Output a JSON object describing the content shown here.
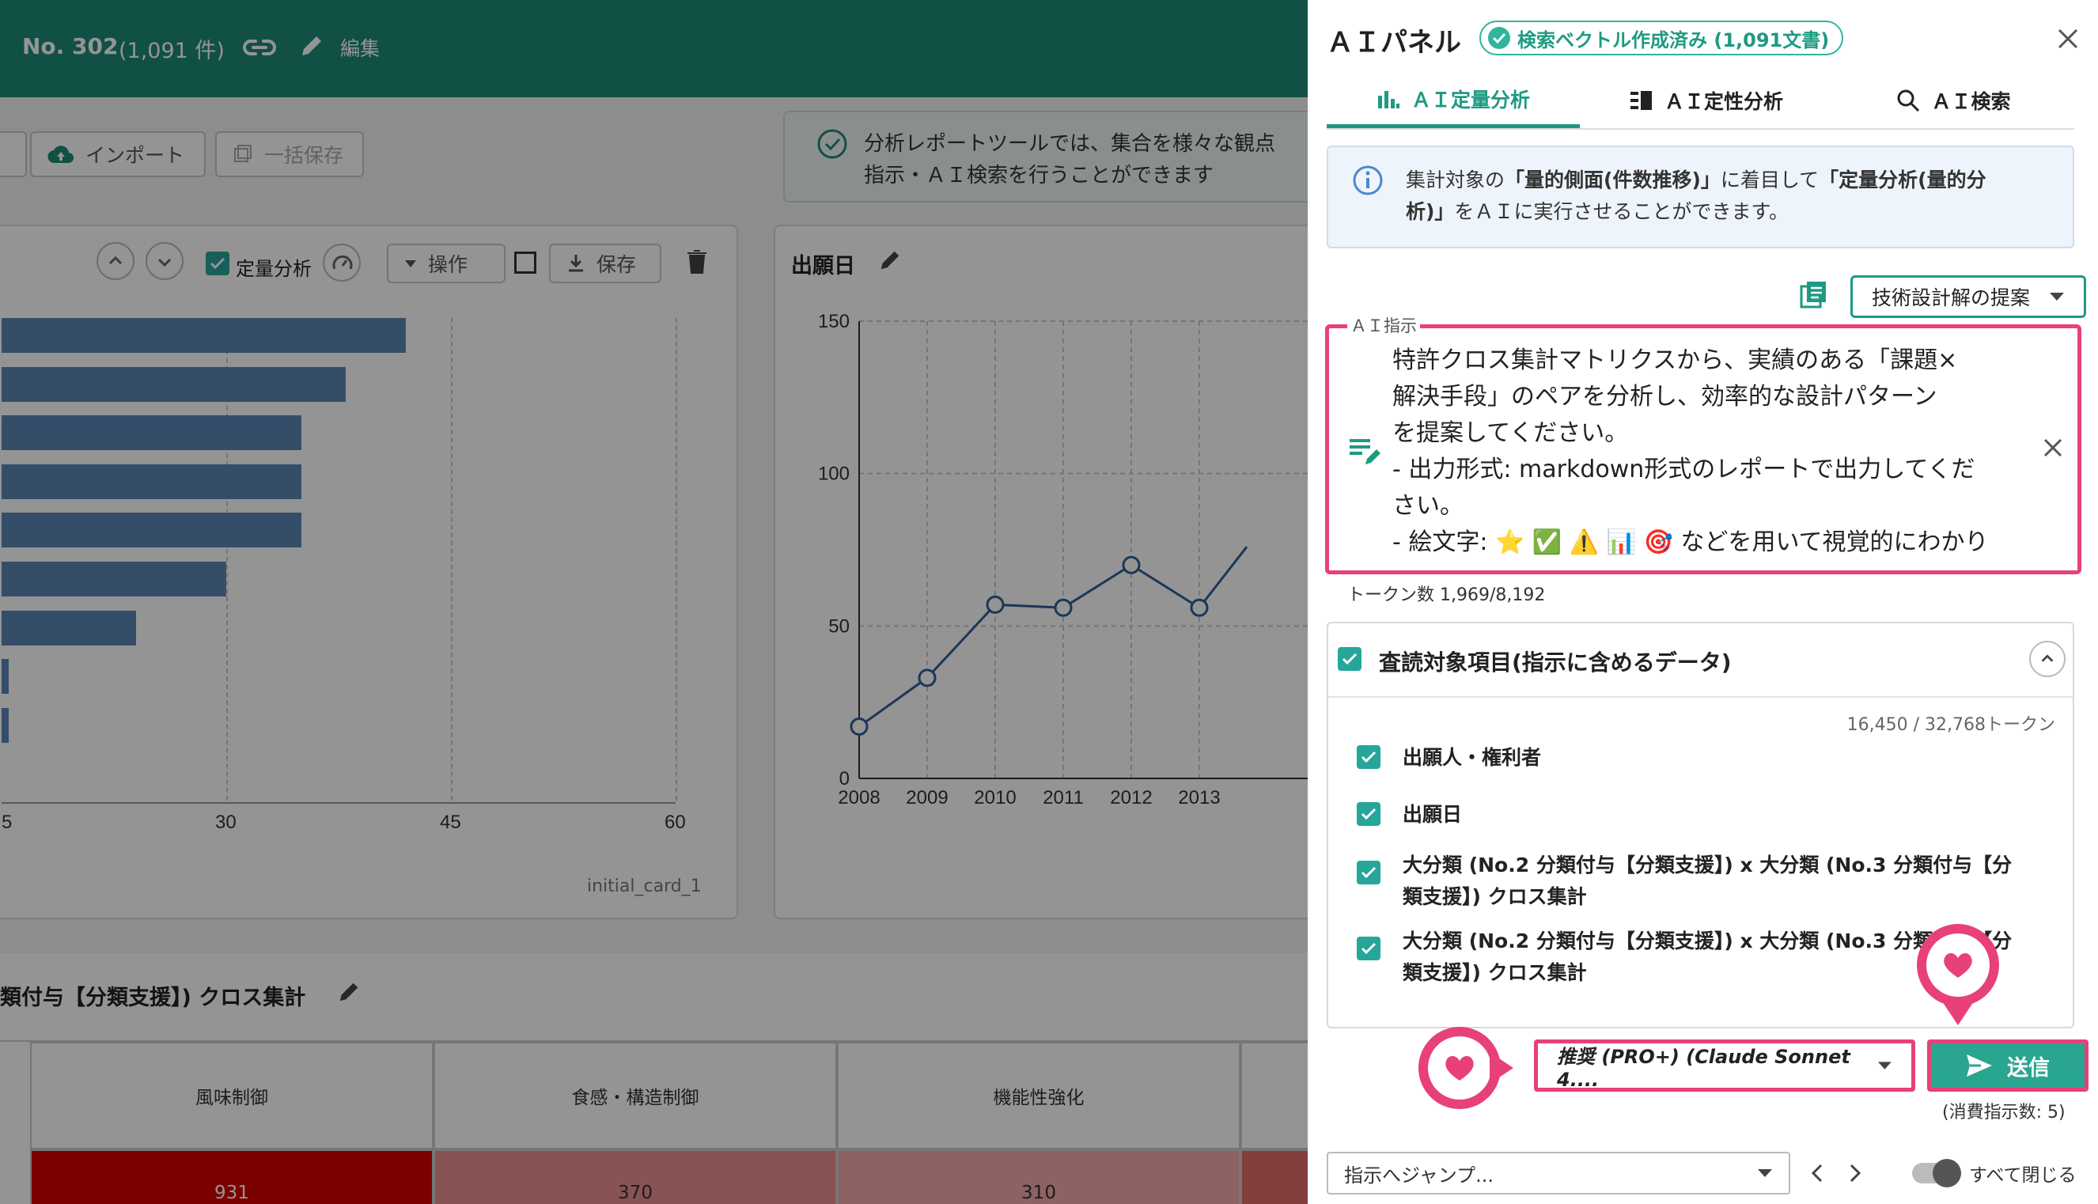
{
  "topbar": {
    "record_no": "No. 302",
    "count": "(1,091 件)",
    "edit_label": "編集"
  },
  "toolbar": {
    "import_label": "インポート",
    "bulk_save_label": "一括保存"
  },
  "info_banner": {
    "line1": "分析レポートツールでは、集合を様々な観点",
    "line2": "指示・ＡＩ検索を行うことができます"
  },
  "card1": {
    "quant_label": "定量分析",
    "operation_label": "操作",
    "save_label": "保存",
    "footer": "initial_card_1"
  },
  "card2": {
    "title": "出願日"
  },
  "chart_data": [
    {
      "type": "bar",
      "orientation": "horizontal",
      "values": [
        42,
        38,
        35,
        35,
        35,
        30,
        24,
        15.5,
        15.5,
        14.5
      ],
      "x_ticks": [
        "5",
        "30",
        "45",
        "60"
      ],
      "xlim_visible": [
        5,
        60
      ],
      "grid": true
    },
    {
      "type": "line",
      "x": [
        "2008",
        "2009",
        "2010",
        "2011",
        "2012",
        "2013"
      ],
      "y": [
        17,
        33,
        57,
        56,
        70,
        56
      ],
      "y_ticks": [
        "0",
        "50",
        "100",
        "150"
      ],
      "ylim": [
        0,
        150
      ],
      "grid": true
    }
  ],
  "cross_table": {
    "title": "類付与【分類支援】) クロス集計",
    "headers": [
      "風味制御",
      "食感・構造制御",
      "機能性強化"
    ],
    "values": [
      "931",
      "370",
      "310"
    ]
  },
  "panel": {
    "title": "ＡＩパネル",
    "badge": "検索ベクトル作成済み (1,091文書)",
    "tabs": [
      {
        "label": "ＡＩ定量分析"
      },
      {
        "label": "ＡＩ定性分析"
      },
      {
        "label": "ＡＩ検索"
      }
    ],
    "info_parts": [
      "集計対象の",
      "「量的側面(件数推移)」",
      "に着目して",
      "「定量分析(量的分",
      "析)」",
      "をＡＩに実行させることができます。"
    ],
    "preset_select": "技術設計解の提案",
    "instruction_label": "ＡＩ指示",
    "instruction_lines": [
      "特許クロス集計マトリクスから、実績のある「課題×",
      "解決手段」のペアを分析し、効率的な設計パターン",
      "を提案してください。",
      "- 出力形式: markdown形式のレポートで出力してくだ",
      "さい。",
      "- 絵文字: ⭐ ✅ ⚠️ 📊 🎯 などを用いて視覚的にわかり"
    ],
    "token_count": "トークン数 1,969/8,192",
    "review_title": "査読対象項目(指示に含めるデータ)",
    "review_tokens": "16,450 / 32,768トークン",
    "review_items": [
      {
        "lines": [
          "出願人・権利者"
        ]
      },
      {
        "lines": [
          "出願日"
        ]
      },
      {
        "lines": [
          "大分類 (No.2 分類付与【分類支援】) x 大分類 (No.3 分類付与【分",
          "類支援】) クロス集計"
        ]
      },
      {
        "lines": [
          "大分類 (No.2 分類付与【分類支援】) x 大分類 (No.3 分類付与【分",
          "類支援】) クロス集計"
        ]
      }
    ],
    "model_select": "推奨 (PRO+) (Claude Sonnet 4....",
    "send_label": "送信",
    "consumption": "(消費指示数: 5)",
    "jump_placeholder": "指示へジャンプ...",
    "close_all_label": "すべて閉じる"
  }
}
